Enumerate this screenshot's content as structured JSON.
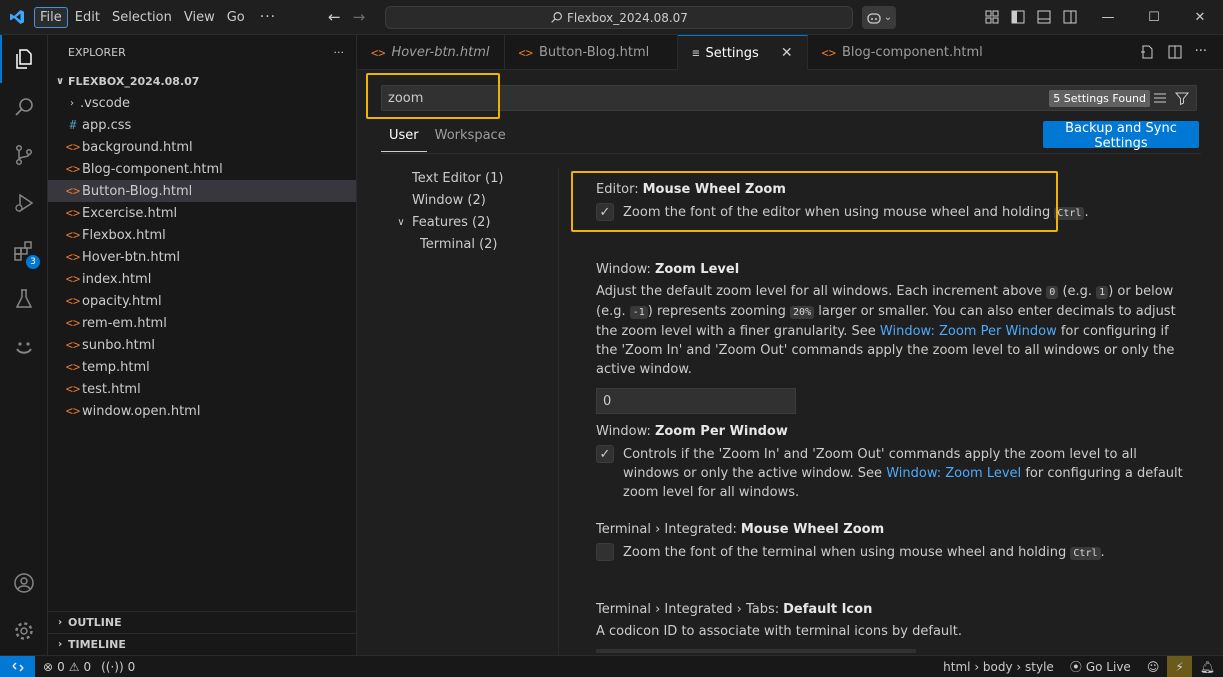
{
  "titlebar": {
    "menus": [
      "File",
      "Edit",
      "Selection",
      "View",
      "Go"
    ],
    "more": "···",
    "command_center": "Flexbox_2024.08.07",
    "window_controls": [
      "minimize-icon",
      "maximize-icon",
      "close-icon"
    ]
  },
  "activity_bar": {
    "items": [
      "explorer-icon",
      "search-icon",
      "source-control-icon",
      "run-debug-icon",
      "extensions-icon",
      "testing-icon",
      "copilot-icon"
    ],
    "extensions_badge": "3",
    "bottom": [
      "account-icon",
      "manage-gear-icon"
    ]
  },
  "sidebar": {
    "title": "EXPLORER",
    "more": "···",
    "folder": "FLEXBOX_2024.08.07",
    "files": [
      {
        "name": ".vscode",
        "type": "folder",
        "icon": ""
      },
      {
        "name": "app.css",
        "type": "css",
        "icon": "#"
      },
      {
        "name": "background.html",
        "type": "html",
        "icon": "<>"
      },
      {
        "name": "Blog-component.html",
        "type": "html",
        "icon": "<>"
      },
      {
        "name": "Button-Blog.html",
        "type": "html",
        "icon": "<>"
      },
      {
        "name": "Excercise.html",
        "type": "html",
        "icon": "<>"
      },
      {
        "name": "Flexbox.html",
        "type": "html",
        "icon": "<>"
      },
      {
        "name": "Hover-btn.html",
        "type": "html",
        "icon": "<>"
      },
      {
        "name": "index.html",
        "type": "html",
        "icon": "<>"
      },
      {
        "name": "opacity.html",
        "type": "html",
        "icon": "<>"
      },
      {
        "name": "rem-em.html",
        "type": "html",
        "icon": "<>"
      },
      {
        "name": "sunbo.html",
        "type": "html",
        "icon": "<>"
      },
      {
        "name": "temp.html",
        "type": "html",
        "icon": "<>"
      },
      {
        "name": "test.html",
        "type": "html",
        "icon": "<>"
      },
      {
        "name": "window.open.html",
        "type": "html",
        "icon": "<>"
      }
    ],
    "selected_file": "Button-Blog.html",
    "outline": "OUTLINE",
    "timeline": "TIMELINE"
  },
  "tabs": [
    {
      "label": "Hover-btn.html",
      "icon": "<>",
      "italic": true
    },
    {
      "label": "Button-Blog.html",
      "icon": "<>",
      "italic": false
    },
    {
      "label": "Settings",
      "icon": "≡",
      "active": true
    },
    {
      "label": "Blog-component.html",
      "icon": "<>",
      "italic": false
    }
  ],
  "settings": {
    "search_value": "zoom",
    "found": "5 Settings Found",
    "scopes": [
      "User",
      "Workspace"
    ],
    "backup_button": "Backup and Sync Settings",
    "toc": [
      {
        "label": "Text Editor (1)",
        "indent": 1
      },
      {
        "label": "Window (2)",
        "indent": 1
      },
      {
        "label": "Features (2)",
        "indent": 0,
        "expanded": true
      },
      {
        "label": "Terminal (2)",
        "indent": 2
      }
    ],
    "items": {
      "editor_zoom": {
        "category": "Editor:",
        "name": "Mouse Wheel Zoom",
        "desc_pre": "Zoom the font of the editor when using mouse wheel and holding",
        "code": "Ctrl",
        "desc_post": ".",
        "checked": true
      },
      "window_zoom_level": {
        "category": "Window:",
        "name": "Zoom Level",
        "d1": "Adjust the default zoom level for all windows. Each increment above",
        "c1": "0",
        "d2": "(e.g.",
        "c2": "1",
        "d3": ") or below (e.g.",
        "c3": "-1",
        "d4": ")",
        "d5": "represents zooming",
        "c4": "20%",
        "d6": "larger or smaller. You can also enter decimals to adjust the zoom level with a finer granularity. See",
        "link": "Window: Zoom Per Window",
        "d7": "for configuring if the 'Zoom In' and 'Zoom Out' commands apply the zoom level to all windows or only the active window.",
        "value": "0"
      },
      "window_zoom_per_window": {
        "category": "Window:",
        "name": "Zoom Per Window",
        "d1": "Controls if the 'Zoom In' and 'Zoom Out' commands apply the zoom level to all windows or only the active window. See",
        "link": "Window: Zoom Level",
        "d2": "for configuring a default zoom level for all windows.",
        "checked": true
      },
      "terminal_zoom": {
        "category": "Terminal › Integrated:",
        "name": "Mouse Wheel Zoom",
        "desc_pre": "Zoom the font of the terminal when using mouse wheel and holding",
        "code": "Ctrl",
        "desc_post": ".",
        "checked": false
      },
      "terminal_default_icon": {
        "category": "Terminal › Integrated › Tabs:",
        "name": "Default Icon",
        "desc": "A codicon ID to associate with terminal icons by default."
      }
    }
  },
  "statusbar": {
    "errors": "0",
    "warnings": "0",
    "ports": "0",
    "breadcrumb": "html › body › style",
    "go_live": "Go Live"
  },
  "colors": {
    "accent": "#0078d4",
    "highlight": "#f0b400",
    "html_icon": "#e37933",
    "css_icon": "#519aba",
    "link": "#4daafc"
  }
}
